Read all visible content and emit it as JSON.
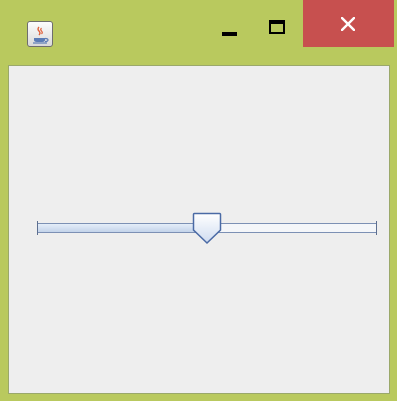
{
  "window": {
    "title": "",
    "app_icon": "java-coffee-cup-icon",
    "controls": {
      "minimize_icon": "minimize-icon",
      "maximize_icon": "maximize-icon",
      "close_icon": "close-icon",
      "close_color": "#c7504f"
    },
    "frame_color": "#b9c95e",
    "content_background": "#eeeeee"
  },
  "slider": {
    "orientation": "horizontal",
    "min": 0,
    "max": 100,
    "value": 50,
    "thumb_icon": "slider-thumb-pointer-down-icon"
  }
}
